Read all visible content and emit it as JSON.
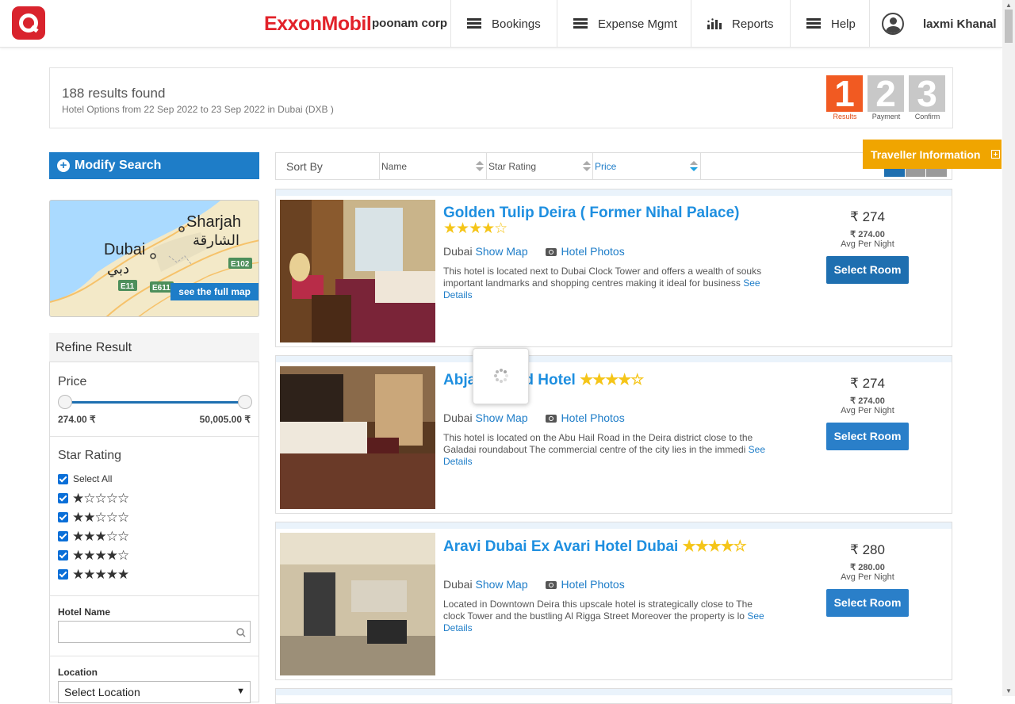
{
  "header": {
    "brand": "ExxonMobil",
    "company": "poonam corp",
    "nav": [
      {
        "label": "Bookings",
        "icon": "menu-icon"
      },
      {
        "label": "Expense Mgmt",
        "icon": "menu-icon"
      },
      {
        "label": "Reports",
        "icon": "bar-chart-icon"
      },
      {
        "label": "Help",
        "icon": "menu-icon"
      }
    ],
    "user": "laxmi Khanal"
  },
  "summary": {
    "count_text": "188 results found",
    "sub_text": "Hotel Options from  22 Sep 2022 to 23 Sep 2022 in Dubai (DXB )"
  },
  "steps": [
    {
      "num": "1",
      "label": "Results",
      "color": "#f15a22"
    },
    {
      "num": "2",
      "label": "Payment",
      "color": "#c8c8c8"
    },
    {
      "num": "3",
      "label": "Confirm",
      "color": "#c8c8c8"
    }
  ],
  "sidebar": {
    "modify_label": "Modify Search",
    "map": {
      "labels": [
        "Sharjah",
        "الشارقة",
        "Dubai",
        "دبي",
        "E102",
        "E11",
        "E611"
      ],
      "link": "see the full map"
    },
    "refine_title": "Refine Result",
    "price": {
      "title": "Price",
      "min": "274.00 ₹",
      "max": "50,005.00 ₹",
      "min_value": 274,
      "max_value": 50005
    },
    "star_rating": {
      "title": "Star Rating",
      "select_all": "Select All",
      "rows": [
        1,
        2,
        3,
        4,
        5
      ]
    },
    "hotel_name": {
      "label": "Hotel Name",
      "placeholder": ""
    },
    "location": {
      "label": "Location",
      "selected": "Select Location"
    }
  },
  "sort": {
    "label": "Sort By",
    "columns": [
      "Name",
      "Star Rating",
      "Price"
    ]
  },
  "traveller_label": "Traveller Information",
  "hotels": [
    {
      "name": "Golden Tulip Deira ( Former Nihal Palace)",
      "stars": 4,
      "city": "Dubai",
      "show_map": "Show Map",
      "photos": "Hotel Photos",
      "desc": "This hotel is located next to Dubai Clock Tower and offers a wealth of souks important landmarks and shopping centres making it ideal for business",
      "see": "See",
      "details": "Details",
      "price": "₹ 274",
      "price_sub": "₹ 274.00",
      "per_night": "Avg Per Night",
      "button": "Select Room"
    },
    {
      "name": "Abjad Grand Hotel",
      "stars": 4,
      "city": "Dubai",
      "show_map": "Show Map",
      "photos": "Hotel Photos",
      "desc": "This hotel is located on the Abu Hail Road in the Deira district close to the Galadai roundabout The commercial centre of the city lies in the immedi",
      "see": "See",
      "details": "Details",
      "price": "₹ 274",
      "price_sub": "₹ 274.00",
      "per_night": "Avg Per Night",
      "button": "Select Room"
    },
    {
      "name": "Aravi Dubai Ex Avari Hotel Dubai",
      "stars": 4,
      "city": "Dubai",
      "show_map": "Show Map",
      "photos": "Hotel Photos",
      "desc": "Located in Downtown Deira this upscale hotel is strategically close to The clock Tower and the bustling Al Rigga Street Moreover the property is lo",
      "see": "See",
      "details": "Details",
      "price": "₹ 280",
      "price_sub": "₹ 280.00",
      "per_night": "Avg Per Night",
      "button": "Select Room"
    }
  ]
}
